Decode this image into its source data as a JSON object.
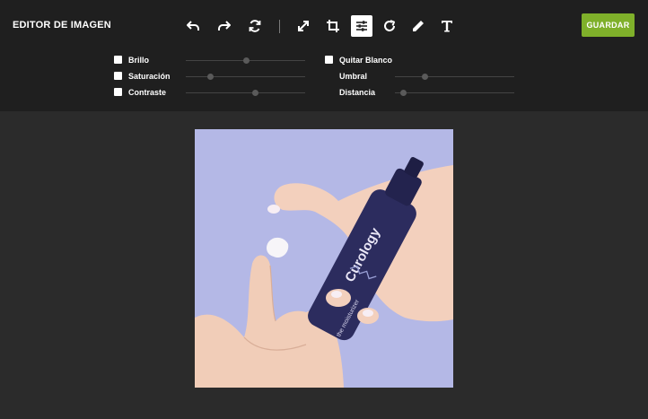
{
  "app": {
    "title": "EDITOR DE IMAGEN"
  },
  "toolbar": {
    "tools": [
      {
        "name": "undo",
        "icon": "undo-icon"
      },
      {
        "name": "redo",
        "icon": "redo-icon"
      },
      {
        "name": "reset",
        "icon": "reset-icon"
      },
      {
        "name": "resize",
        "icon": "resize-icon"
      },
      {
        "name": "crop",
        "icon": "crop-icon"
      },
      {
        "name": "adjust",
        "icon": "adjust-sliders-icon",
        "active": true
      },
      {
        "name": "rotate",
        "icon": "rotate-icon"
      },
      {
        "name": "draw",
        "icon": "pencil-icon"
      },
      {
        "name": "text",
        "icon": "text-icon"
      }
    ],
    "save_label": "GUARDAR"
  },
  "adjustments": {
    "left": [
      {
        "label": "Brillo",
        "checked": false,
        "value": 0.5
      },
      {
        "label": "Saturación",
        "checked": false,
        "value": 0.2
      },
      {
        "label": "Contraste",
        "checked": false,
        "value": 0.58
      }
    ],
    "right": [
      {
        "label": "Quitar Blanco",
        "checked": false
      },
      {
        "label": "Umbral",
        "value": 0.25
      },
      {
        "label": "Distancia",
        "value": 0.07
      }
    ]
  },
  "image": {
    "brand_text": "Curology",
    "bottle_text": "the moisturizer",
    "background_color": "#b4b8e6",
    "bottle_color": "#2c2c5e"
  },
  "colors": {
    "accent": "#7fb02a",
    "topbar": "#1f1f1f",
    "workspace": "#2b2b2b"
  }
}
